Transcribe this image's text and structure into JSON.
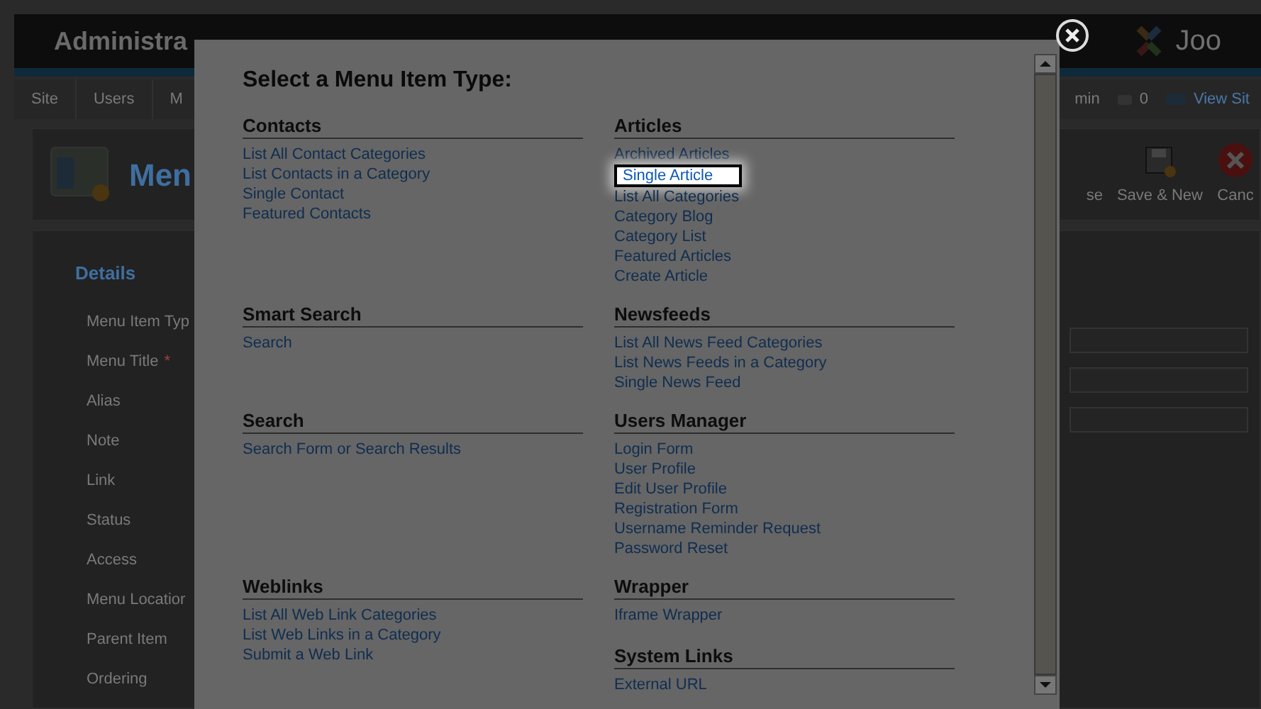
{
  "background": {
    "header_title": "Administra",
    "header_logo_text": "Joo",
    "nav_left": [
      "Site",
      "Users",
      "M"
    ],
    "nav_right": [
      {
        "kind": "text",
        "label": "min"
      },
      {
        "kind": "count",
        "label": "0"
      },
      {
        "kind": "link",
        "label": "View Sit"
      }
    ],
    "page_title": "Men",
    "toolbar": [
      {
        "kind": "text",
        "label": "se"
      },
      {
        "kind": "save",
        "label": "Save & New"
      },
      {
        "kind": "cancel",
        "label": "Canc"
      }
    ],
    "details_legend": "Details",
    "fields": [
      {
        "label": "Menu Item Typ"
      },
      {
        "label": "Menu Title",
        "marker": "*"
      },
      {
        "label": "Alias"
      },
      {
        "label": "Note"
      },
      {
        "label": "Link"
      },
      {
        "label": "Status"
      },
      {
        "label": "Access"
      },
      {
        "label": "Menu Locatior"
      },
      {
        "label": "Parent Item"
      },
      {
        "label": "Ordering"
      }
    ]
  },
  "modal": {
    "title": "Select a Menu Item Type:",
    "rows": [
      {
        "cells": [
          [
            {
              "heading": "Contacts",
              "items": [
                {
                  "label": "List All Contact Categories",
                  "highlighted": false
                },
                {
                  "label": "List Contacts in a Category",
                  "highlighted": false
                },
                {
                  "label": "Single Contact",
                  "highlighted": false
                },
                {
                  "label": "Featured Contacts",
                  "highlighted": false
                }
              ]
            }
          ],
          [
            {
              "heading": "Articles",
              "items": [
                {
                  "label": "Archived Articles",
                  "highlighted": false
                },
                {
                  "label": "Single Article",
                  "highlighted": true
                },
                {
                  "label": "List All Categories",
                  "highlighted": false
                },
                {
                  "label": "Category Blog",
                  "highlighted": false
                },
                {
                  "label": "Category List",
                  "highlighted": false
                },
                {
                  "label": "Featured Articles",
                  "highlighted": false
                },
                {
                  "label": "Create Article",
                  "highlighted": false
                }
              ]
            }
          ]
        ]
      },
      {
        "cells": [
          [
            {
              "heading": "Smart Search",
              "items": [
                {
                  "label": "Search",
                  "highlighted": false
                }
              ]
            }
          ],
          [
            {
              "heading": "Newsfeeds",
              "items": [
                {
                  "label": "List All News Feed Categories",
                  "highlighted": false
                },
                {
                  "label": "List News Feeds in a Category",
                  "highlighted": false
                },
                {
                  "label": "Single News Feed",
                  "highlighted": false
                }
              ]
            }
          ]
        ]
      },
      {
        "cells": [
          [
            {
              "heading": "Search",
              "items": [
                {
                  "label": "Search Form or Search Results",
                  "highlighted": false
                }
              ]
            }
          ],
          [
            {
              "heading": "Users Manager",
              "items": [
                {
                  "label": "Login Form",
                  "highlighted": false
                },
                {
                  "label": "User Profile",
                  "highlighted": false
                },
                {
                  "label": "Edit User Profile",
                  "highlighted": false
                },
                {
                  "label": "Registration Form",
                  "highlighted": false
                },
                {
                  "label": "Username Reminder Request",
                  "highlighted": false
                },
                {
                  "label": "Password Reset",
                  "highlighted": false
                }
              ]
            }
          ]
        ]
      },
      {
        "cells": [
          [
            {
              "heading": "Weblinks",
              "items": [
                {
                  "label": "List All Web Link Categories",
                  "highlighted": false
                },
                {
                  "label": "List Web Links in a Category",
                  "highlighted": false
                },
                {
                  "label": "Submit a Web Link",
                  "highlighted": false
                }
              ]
            }
          ],
          [
            {
              "heading": "Wrapper",
              "items": [
                {
                  "label": "Iframe Wrapper",
                  "highlighted": false
                }
              ]
            },
            {
              "heading": "System Links",
              "items": [
                {
                  "label": "External URL",
                  "highlighted": false
                }
              ]
            }
          ]
        ]
      }
    ]
  }
}
